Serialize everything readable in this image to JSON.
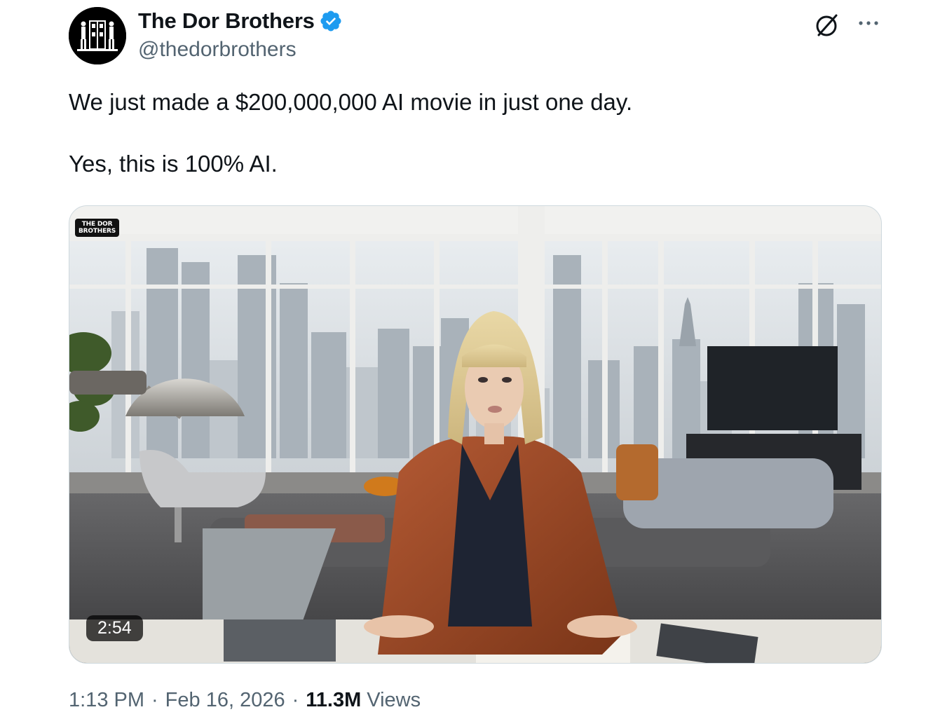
{
  "author": {
    "display_name": "The Dor Brothers",
    "handle": "@thedorbrothers",
    "verified_color": "#1d9bf0"
  },
  "icons": {
    "grok": "grok-icon",
    "more": "more-horizontal-icon",
    "verified": "verified-badge-icon"
  },
  "tweet": {
    "paragraphs": [
      "We just made a $200,000,000 AI movie in just one day.",
      "Yes, this is 100% AI."
    ]
  },
  "media": {
    "watermark_line1": "THE DOR",
    "watermark_line2": "BROTHERS",
    "duration": "2:54"
  },
  "meta": {
    "time": "1:13 PM",
    "date": "Feb 16, 2026",
    "views_count": "11.3M",
    "views_label": "Views",
    "separator": "·"
  }
}
